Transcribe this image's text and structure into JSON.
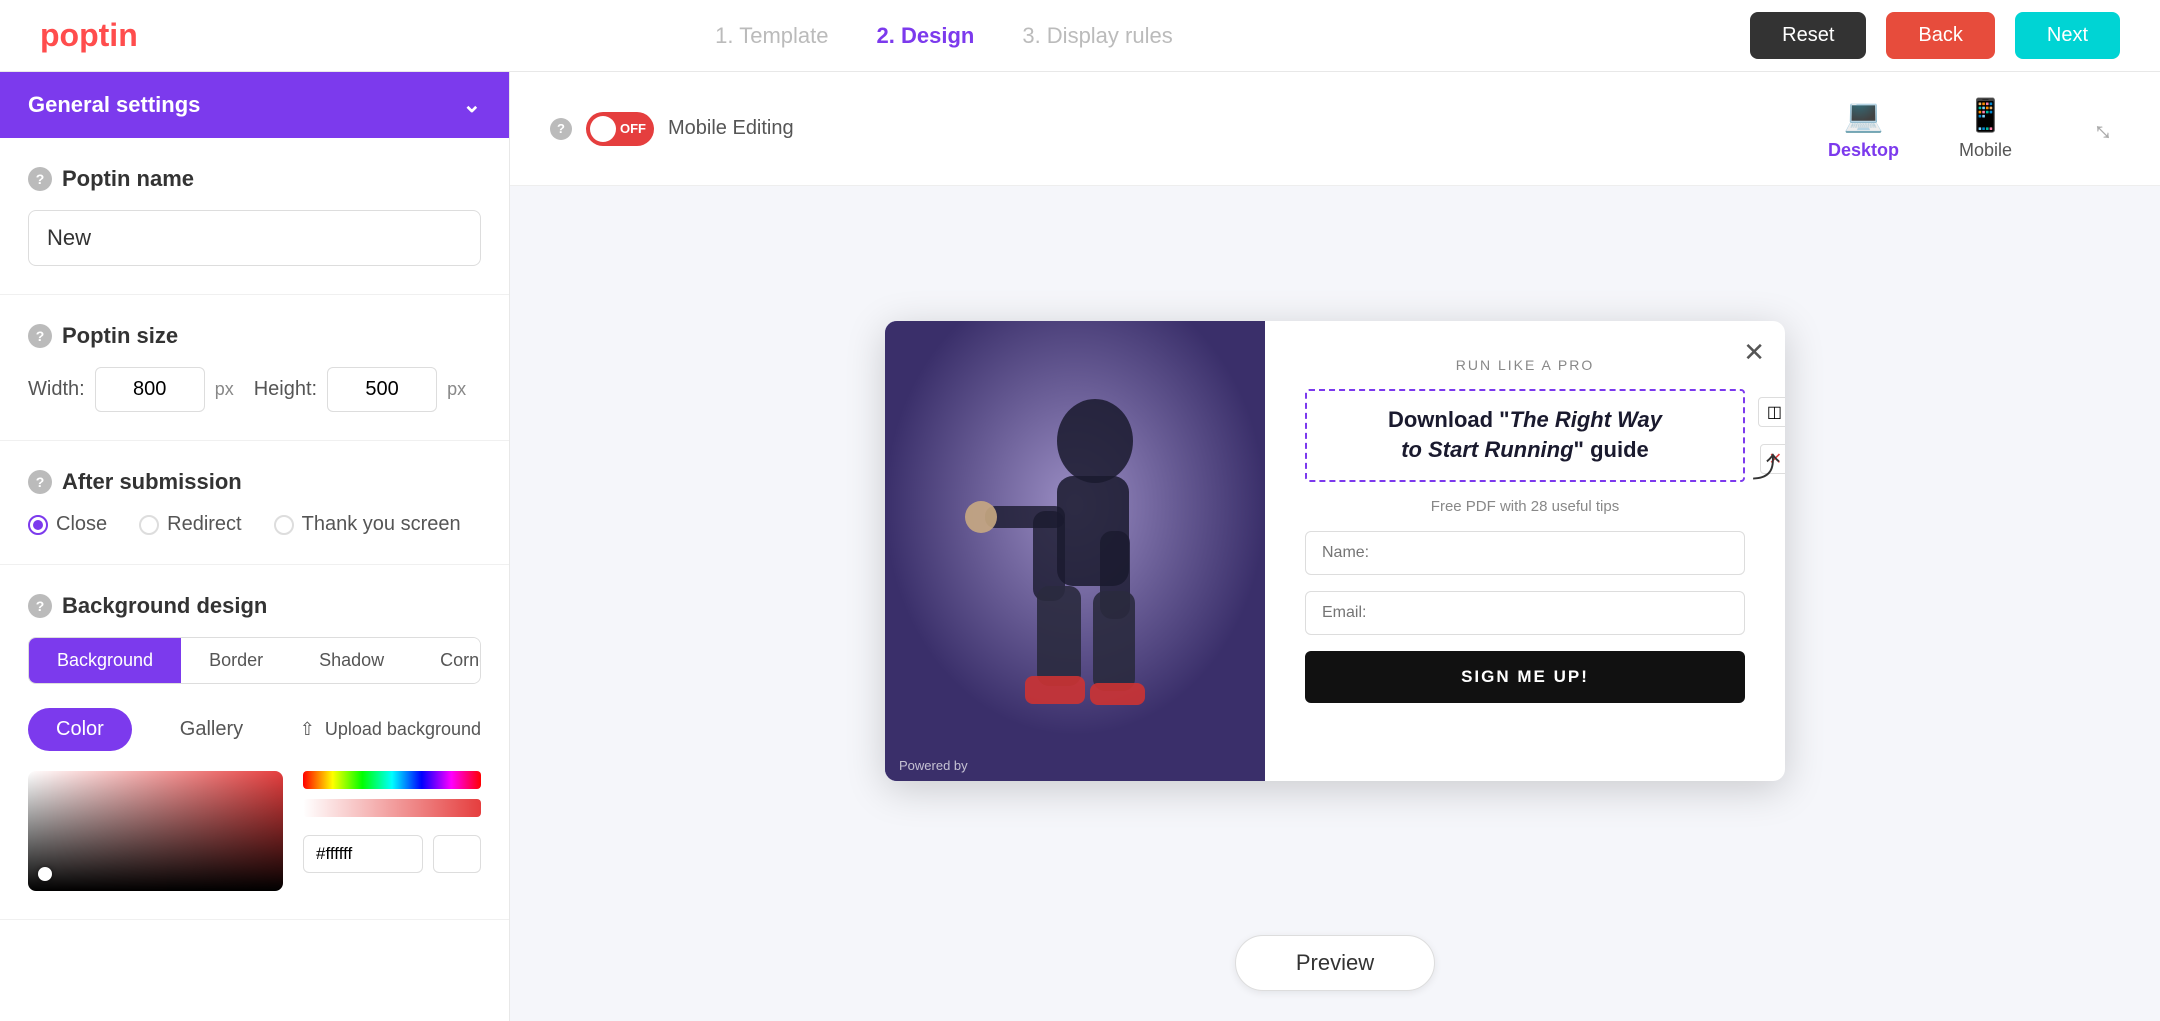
{
  "app": {
    "logo": "poptin"
  },
  "nav": {
    "steps": [
      {
        "label": "1. Template",
        "state": "inactive"
      },
      {
        "label": "2. Design",
        "state": "active"
      },
      {
        "label": "3. Display rules",
        "state": "inactive"
      }
    ],
    "buttons": {
      "reset": "Reset",
      "back": "Back",
      "next": "Next"
    }
  },
  "left_panel": {
    "general_settings_label": "General settings",
    "poptin_name": {
      "label": "Poptin name",
      "value": "New"
    },
    "poptin_size": {
      "label": "Poptin size",
      "width_label": "Width:",
      "width_value": "800",
      "height_label": "Height:",
      "height_value": "500",
      "px": "px"
    },
    "after_submission": {
      "label": "After submission",
      "options": [
        {
          "label": "Close",
          "selected": true
        },
        {
          "label": "Redirect",
          "selected": false
        },
        {
          "label": "Thank you screen",
          "selected": false
        }
      ]
    },
    "background_design": {
      "label": "Background design",
      "tabs": [
        "Background",
        "Border",
        "Shadow",
        "Corners"
      ],
      "active_tab": "Background",
      "color_toggle": "Color",
      "gallery_toggle": "Gallery",
      "upload_label": "Upload background",
      "hex_value": "#ffffff"
    }
  },
  "right_panel": {
    "mobile_editing": {
      "label": "Mobile Editing",
      "state": "OFF"
    },
    "devices": [
      {
        "label": "Desktop",
        "icon": "desktop"
      },
      {
        "label": "Mobile",
        "icon": "mobile"
      }
    ],
    "popup": {
      "run_label": "RUN LIKE A PRO",
      "title_line1": "Download \"",
      "title_italic": "The Right Way",
      "title_line2": " to Start Running",
      "title_end": "\" guide",
      "subtitle": "Free PDF with 28 useful tips",
      "name_placeholder": "Name:",
      "email_placeholder": "Email:",
      "submit_label": "SIGN ME UP!",
      "powered_by": "Powered by"
    },
    "preview_button": "Preview"
  }
}
